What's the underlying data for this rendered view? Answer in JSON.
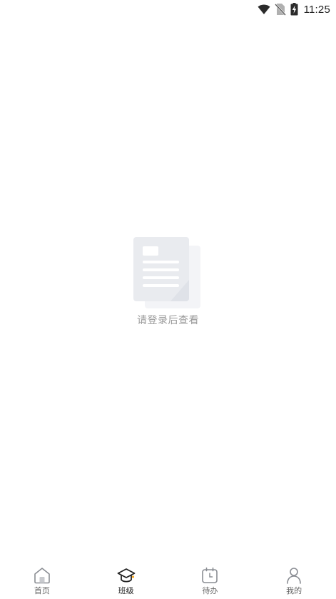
{
  "status_bar": {
    "time": "11:25",
    "icons": [
      "wifi-icon",
      "no-sim-icon",
      "battery-charging-icon"
    ]
  },
  "empty_state": {
    "icon": "document-icon",
    "message": "请登录后查看"
  },
  "tab_bar": {
    "active_index": 1,
    "tabs": [
      {
        "label": "首页",
        "icon": "home-icon"
      },
      {
        "label": "班级",
        "icon": "graduation-cap-icon"
      },
      {
        "label": "待办",
        "icon": "calendar-clock-icon"
      },
      {
        "label": "我的",
        "icon": "person-icon"
      }
    ]
  },
  "colors": {
    "accent": "#f5a623",
    "text_muted": "#999999",
    "icon_gray": "#b5b8bf",
    "illustration": "#e9ebef"
  }
}
